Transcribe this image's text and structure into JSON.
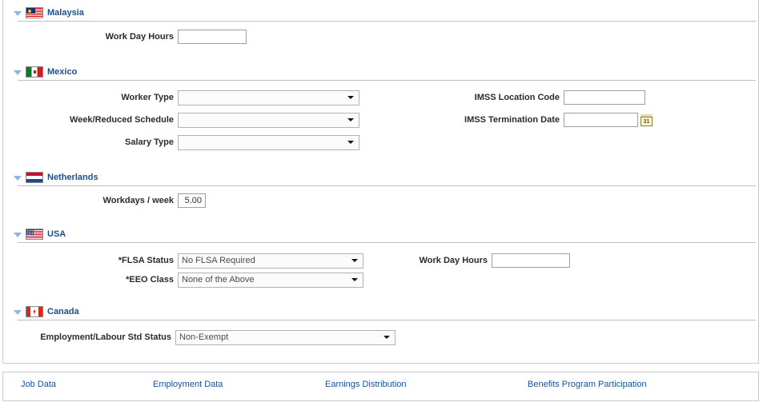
{
  "sections": [
    {
      "key": "malaysia",
      "title": "Malaysia",
      "flag": "malaysia-flag-icon",
      "twisty": "collapse-triangle-icon",
      "fields": [
        {
          "label": "Work Day Hours",
          "type": "text",
          "value": ""
        }
      ]
    },
    {
      "key": "mexico",
      "title": "Mexico",
      "flag": "mexico-flag-icon",
      "twisty": "collapse-triangle-icon",
      "fields": [
        {
          "label": "Worker Type",
          "type": "dropdown",
          "value": ""
        },
        {
          "label": "Week/Reduced Schedule",
          "type": "dropdown",
          "value": ""
        },
        {
          "label": "Salary Type",
          "type": "dropdown",
          "value": ""
        },
        {
          "label": "IMSS Location Code",
          "type": "text",
          "value": ""
        },
        {
          "label": "IMSS Termination Date",
          "type": "date",
          "value": "",
          "icon": "calendar-icon",
          "icon_text": "31"
        }
      ]
    },
    {
      "key": "netherlands",
      "title": "Netherlands",
      "flag": "netherlands-flag-icon",
      "twisty": "collapse-triangle-icon",
      "fields": [
        {
          "label": "Workdays / week",
          "type": "text",
          "value": "5.00"
        }
      ]
    },
    {
      "key": "usa",
      "title": "USA",
      "flag": "usa-flag-icon",
      "twisty": "collapse-triangle-icon",
      "fields": [
        {
          "label": "*FLSA Status",
          "type": "dropdown",
          "value": "No FLSA Required"
        },
        {
          "label": "*EEO Class",
          "type": "dropdown",
          "value": "None of the Above"
        },
        {
          "label": "Work Day Hours",
          "type": "text",
          "value": ""
        }
      ]
    },
    {
      "key": "canada",
      "title": "Canada",
      "flag": "canada-flag-icon",
      "twisty": "collapse-triangle-icon",
      "fields": [
        {
          "label": "Employment/Labour Std Status",
          "type": "dropdown",
          "value": "Non-Exempt"
        }
      ]
    }
  ],
  "links": [
    {
      "label": "Job Data"
    },
    {
      "label": "Employment Data"
    },
    {
      "label": "Earnings Distribution"
    },
    {
      "label": "Benefits Program Participation"
    }
  ],
  "colors": {
    "link": "#17509e",
    "section_title": "#1b4f8a",
    "label": "#2b2b2b",
    "border": "#c3ccd4"
  }
}
